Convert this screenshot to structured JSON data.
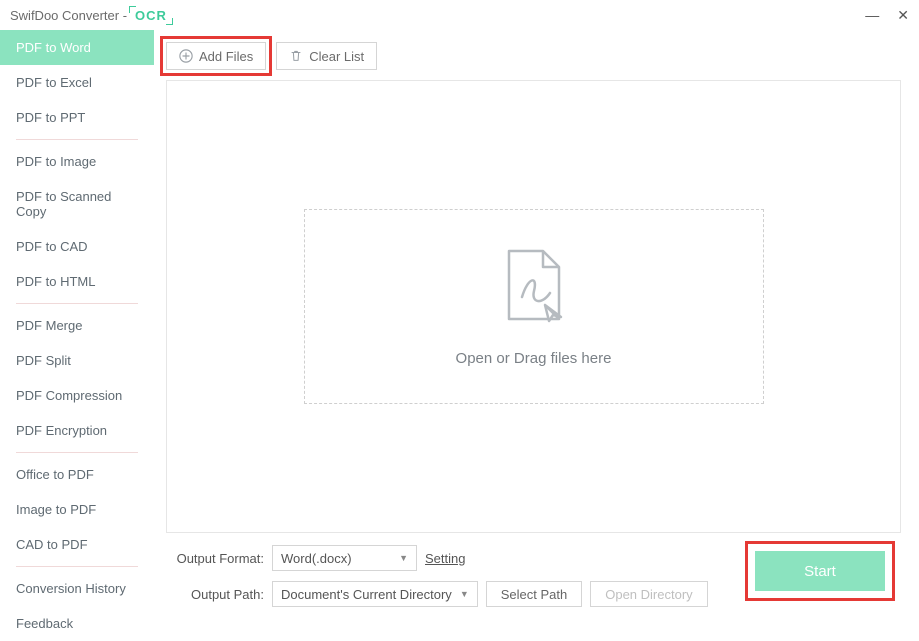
{
  "titlebar": {
    "app_name": "SwifDoo Converter -",
    "ocr_label": "OCR"
  },
  "sidebar": {
    "groups": [
      [
        "PDF to Word",
        "PDF to Excel",
        "PDF to PPT"
      ],
      [
        "PDF to Image",
        "PDF to Scanned Copy",
        "PDF to CAD",
        "PDF to HTML"
      ],
      [
        "PDF Merge",
        "PDF Split",
        "PDF Compression",
        "PDF Encryption"
      ],
      [
        "Office to PDF",
        "Image to PDF",
        "CAD to PDF"
      ],
      [
        "Conversion History",
        "Feedback"
      ]
    ],
    "active": "PDF to Word"
  },
  "toolbar": {
    "add_files": "Add Files",
    "clear_list": "Clear List"
  },
  "dropzone": {
    "text": "Open or Drag files here"
  },
  "footer": {
    "output_format_label": "Output Format:",
    "output_format_value": "Word(.docx)",
    "setting_label": "Setting",
    "output_path_label": "Output Path:",
    "output_path_value": "Document's Current Directory",
    "select_path": "Select Path",
    "open_directory": "Open Directory",
    "start": "Start"
  }
}
